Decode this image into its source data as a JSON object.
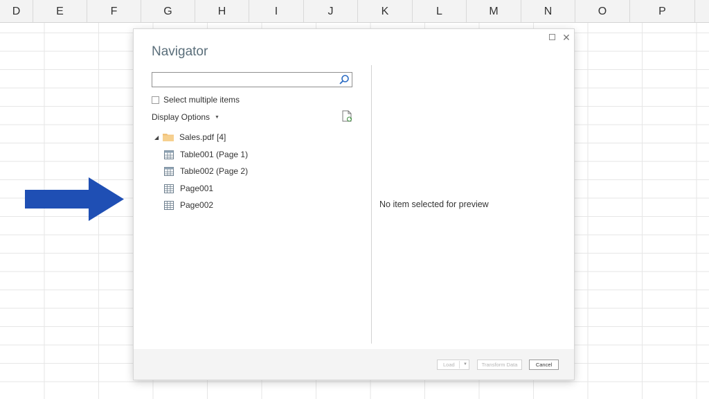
{
  "columns": [
    "D",
    "E",
    "F",
    "G",
    "H",
    "I",
    "J",
    "K",
    "L",
    "M",
    "N",
    "O",
    "P"
  ],
  "dialog": {
    "title": "Navigator",
    "search": {
      "value": "",
      "placeholder": ""
    },
    "select_multiple_label": "Select multiple items",
    "display_options_label": "Display Options",
    "tree": {
      "root": {
        "label": "Sales.pdf",
        "count": "[4]"
      },
      "items": [
        {
          "label": "Table001 (Page 1)",
          "kind": "table"
        },
        {
          "label": "Table002 (Page 2)",
          "kind": "table"
        },
        {
          "label": "Page001",
          "kind": "page"
        },
        {
          "label": "Page002",
          "kind": "page"
        }
      ]
    },
    "preview_message": "No item selected for preview",
    "buttons": {
      "load": "Load",
      "transform": "Transform Data",
      "cancel": "Cancel"
    }
  },
  "colors": {
    "arrow": "#1f4fb4",
    "title": "#5a6e7a",
    "folder": "#f1c27a"
  }
}
